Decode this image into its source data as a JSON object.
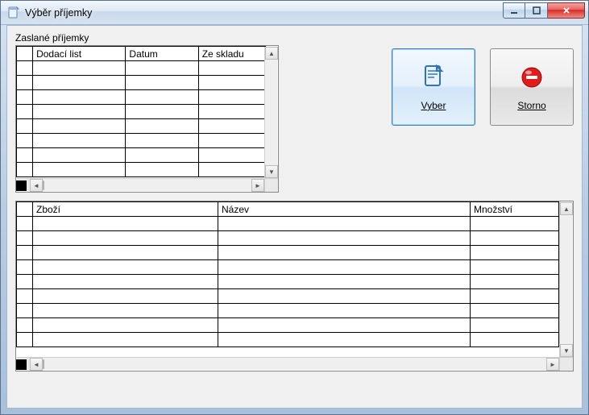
{
  "window": {
    "title": "Výběr příjemky"
  },
  "sections": {
    "sent": "Zaslané příjemky"
  },
  "grid1": {
    "headers": {
      "c1": "Dodací list",
      "c2": "Datum",
      "c3": "Ze skladu"
    },
    "empty_rows": 8
  },
  "grid2": {
    "headers": {
      "c1": "Zboží",
      "c2": "Název",
      "c3": "Množství"
    },
    "empty_rows": 9
  },
  "buttons": {
    "select": "Vyber",
    "cancel": "Storno"
  }
}
